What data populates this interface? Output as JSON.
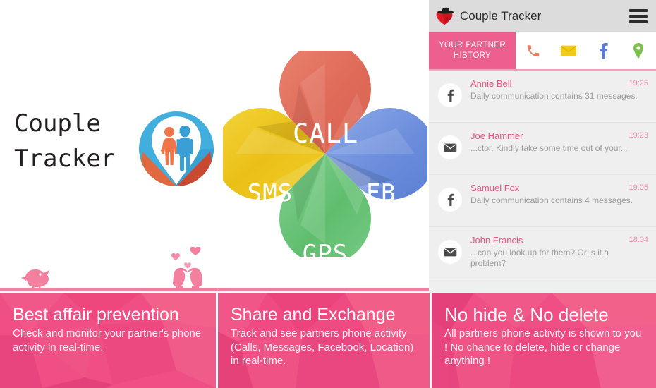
{
  "logo": {
    "line1": "Couple",
    "line2": "Tracker",
    "mark_name": "couple-map-pin-logo"
  },
  "petals": [
    {
      "key": "call",
      "label": "CALL",
      "color": "#e06a58",
      "color_light": "#e8836f",
      "position": "top"
    },
    {
      "key": "sms",
      "label": "SMS",
      "color": "#ecc21a",
      "color_light": "#f2d53a",
      "position": "left"
    },
    {
      "key": "fb",
      "label": "FB",
      "color": "#6b8ddb",
      "color_light": "#8aa7e6",
      "position": "right"
    },
    {
      "key": "gps",
      "label": "GPS",
      "color": "#5fbe6e",
      "color_light": "#82cf8e",
      "position": "bottom"
    }
  ],
  "decoration": {
    "line_color": "#f4809f",
    "bird_left_name": "bird-icon",
    "bird_pair_name": "love-birds-icon",
    "hearts_name": "hearts-icon"
  },
  "phone": {
    "titlebar": {
      "app_icon_name": "detective-heart-icon",
      "title": "Couple Tracker",
      "menu_name": "hamburger-menu-icon",
      "background": "#dcdcdc"
    },
    "tabs": {
      "active_label": "YOUR PARTNER\nHISTORY",
      "active_label_line1": "YOUR PARTNER",
      "active_label_line2": "HISTORY",
      "active_color": "#ec5f8e",
      "icons": [
        {
          "name": "phone-icon",
          "color": "#ef7d63"
        },
        {
          "name": "envelope-icon",
          "color": "#f2cc16"
        },
        {
          "name": "facebook-icon",
          "color": "#5b7bd5"
        },
        {
          "name": "map-pin-icon",
          "color": "#7cc24a"
        }
      ]
    },
    "history": [
      {
        "icon": "facebook-icon",
        "name": "Annie Bell",
        "snippet": "Daily communication contains 31 messages.",
        "time": "19:25"
      },
      {
        "icon": "envelope-icon",
        "name": "Joe Hammer",
        "snippet": "...ctor. Kindly take some time out of your...",
        "time": "19:23"
      },
      {
        "icon": "facebook-icon",
        "name": "Samuel Fox",
        "snippet": "Daily communication contains 4 messages.",
        "time": "19:05"
      },
      {
        "icon": "envelope-icon",
        "name": "John Francis",
        "snippet": "...can you look up for them? Or is it a problem?",
        "time": "18:04"
      }
    ]
  },
  "banners": [
    {
      "title": "Best affair prevention",
      "subtitle": "Check and monitor your partner's phone activity in real-time."
    },
    {
      "title": "Share and Exchange",
      "subtitle": "Track and see partners phone activity (Calls, Messages, Facebook, Location) in real-time."
    },
    {
      "title": "No hide & No delete",
      "subtitle": "All partners phone activity is shown to you ! No chance to delete, hide or change anything !"
    }
  ],
  "colors": {
    "pink_primary": "#ec5f8e",
    "pink_banner": "#f0487d",
    "pink_banner_alt": "#ef5b8d",
    "text_dark": "#231f20",
    "list_bg": "#efefef"
  }
}
